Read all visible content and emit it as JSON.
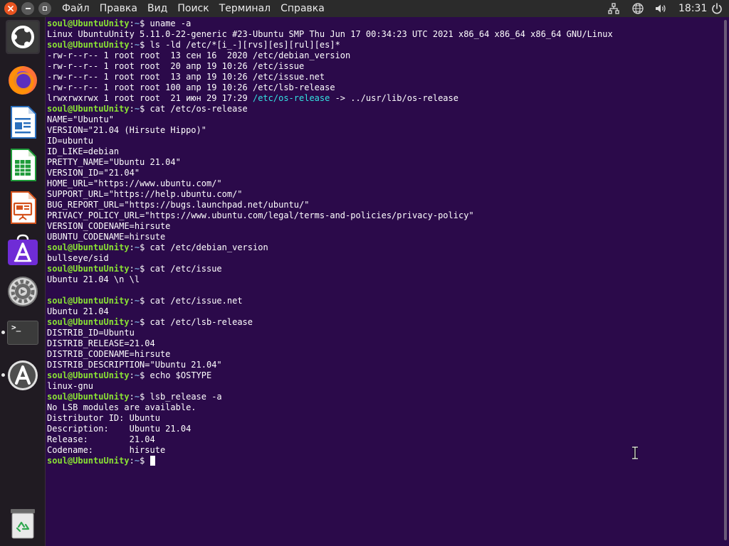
{
  "top_panel": {
    "menu": [
      "Файл",
      "Правка",
      "Вид",
      "Поиск",
      "Терминал",
      "Справка"
    ],
    "clock": "18:31",
    "accent": "#e95420"
  },
  "launcher": {
    "items": [
      {
        "name": "ubuntu-dash-icon",
        "icon": "ubuntu-logo",
        "active": true
      },
      {
        "name": "firefox-icon",
        "icon": "firefox"
      },
      {
        "name": "libreoffice-writer-icon",
        "icon": "writer"
      },
      {
        "name": "libreoffice-calc-icon",
        "icon": "calc"
      },
      {
        "name": "libreoffice-impress-icon",
        "icon": "impress"
      },
      {
        "name": "app-center-icon",
        "icon": "app-store"
      },
      {
        "name": "settings-icon",
        "icon": "gear"
      },
      {
        "name": "terminal-icon",
        "icon": "terminal",
        "running": true
      },
      {
        "name": "software-updater-icon",
        "icon": "software-updater",
        "running": true
      },
      {
        "name": "trash-icon",
        "icon": "trash"
      }
    ],
    "terminal_glyph": ">_"
  },
  "terminal": {
    "colors": {
      "user": "#8ae234",
      "path": "#729fcf",
      "link": "#34e2e2",
      "background": "#2b0a4a"
    },
    "lines": [
      {
        "type": "prompt",
        "user": "soul@UbuntuUnity",
        "path": "~",
        "cmd": "uname -a"
      },
      {
        "type": "out",
        "text": "Linux UbuntuUnity 5.11.0-22-generic #23-Ubuntu SMP Thu Jun 17 00:34:23 UTC 2021 x86_64 x86_64 x86_64 GNU/Linux"
      },
      {
        "type": "prompt",
        "user": "soul@UbuntuUnity",
        "path": "~",
        "cmd": "ls -ld /etc/*[i_-][rvs][es][rul][es]*"
      },
      {
        "type": "out",
        "text": "-rw-r--r-- 1 root root  13 сен 16  2020 /etc/debian_version"
      },
      {
        "type": "out",
        "text": "-rw-r--r-- 1 root root  20 апр 19 10:26 /etc/issue"
      },
      {
        "type": "out",
        "text": "-rw-r--r-- 1 root root  13 апр 19 10:26 /etc/issue.net"
      },
      {
        "type": "out",
        "text": "-rw-r--r-- 1 root root 100 апр 19 10:26 /etc/lsb-release"
      },
      {
        "type": "link",
        "pre": "lrwxrwxrwx 1 root root  21 июн 29 17:29 ",
        "link": "/etc/os-release",
        "post": " -> ../usr/lib/os-release"
      },
      {
        "type": "prompt",
        "user": "soul@UbuntuUnity",
        "path": "~",
        "cmd": "cat /etc/os-release"
      },
      {
        "type": "out",
        "text": "NAME=\"Ubuntu\""
      },
      {
        "type": "out",
        "text": "VERSION=\"21.04 (Hirsute Hippo)\""
      },
      {
        "type": "out",
        "text": "ID=ubuntu"
      },
      {
        "type": "out",
        "text": "ID_LIKE=debian"
      },
      {
        "type": "out",
        "text": "PRETTY_NAME=\"Ubuntu 21.04\""
      },
      {
        "type": "out",
        "text": "VERSION_ID=\"21.04\""
      },
      {
        "type": "out",
        "text": "HOME_URL=\"https://www.ubuntu.com/\""
      },
      {
        "type": "out",
        "text": "SUPPORT_URL=\"https://help.ubuntu.com/\""
      },
      {
        "type": "out",
        "text": "BUG_REPORT_URL=\"https://bugs.launchpad.net/ubuntu/\""
      },
      {
        "type": "out",
        "text": "PRIVACY_POLICY_URL=\"https://www.ubuntu.com/legal/terms-and-policies/privacy-policy\""
      },
      {
        "type": "out",
        "text": "VERSION_CODENAME=hirsute"
      },
      {
        "type": "out",
        "text": "UBUNTU_CODENAME=hirsute"
      },
      {
        "type": "prompt",
        "user": "soul@UbuntuUnity",
        "path": "~",
        "cmd": "cat /etc/debian_version"
      },
      {
        "type": "out",
        "text": "bullseye/sid"
      },
      {
        "type": "prompt",
        "user": "soul@UbuntuUnity",
        "path": "~",
        "cmd": "cat /etc/issue"
      },
      {
        "type": "out",
        "text": "Ubuntu 21.04 \\n \\l"
      },
      {
        "type": "out",
        "text": ""
      },
      {
        "type": "prompt",
        "user": "soul@UbuntuUnity",
        "path": "~",
        "cmd": "cat /etc/issue.net"
      },
      {
        "type": "out",
        "text": "Ubuntu 21.04"
      },
      {
        "type": "prompt",
        "user": "soul@UbuntuUnity",
        "path": "~",
        "cmd": "cat /etc/lsb-release"
      },
      {
        "type": "out",
        "text": "DISTRIB_ID=Ubuntu"
      },
      {
        "type": "out",
        "text": "DISTRIB_RELEASE=21.04"
      },
      {
        "type": "out",
        "text": "DISTRIB_CODENAME=hirsute"
      },
      {
        "type": "out",
        "text": "DISTRIB_DESCRIPTION=\"Ubuntu 21.04\""
      },
      {
        "type": "prompt",
        "user": "soul@UbuntuUnity",
        "path": "~",
        "cmd": "echo $OSTYPE"
      },
      {
        "type": "out",
        "text": "linux-gnu"
      },
      {
        "type": "prompt",
        "user": "soul@UbuntuUnity",
        "path": "~",
        "cmd": "lsb_release -a"
      },
      {
        "type": "out",
        "text": "No LSB modules are available."
      },
      {
        "type": "out",
        "text": "Distributor ID:\tUbuntu"
      },
      {
        "type": "out",
        "text": "Description:\tUbuntu 21.04"
      },
      {
        "type": "out",
        "text": "Release:\t21.04"
      },
      {
        "type": "out",
        "text": "Codename:\thirsute"
      },
      {
        "type": "prompt",
        "user": "soul@UbuntuUnity",
        "path": "~",
        "cmd": "",
        "cursor": true
      }
    ]
  }
}
